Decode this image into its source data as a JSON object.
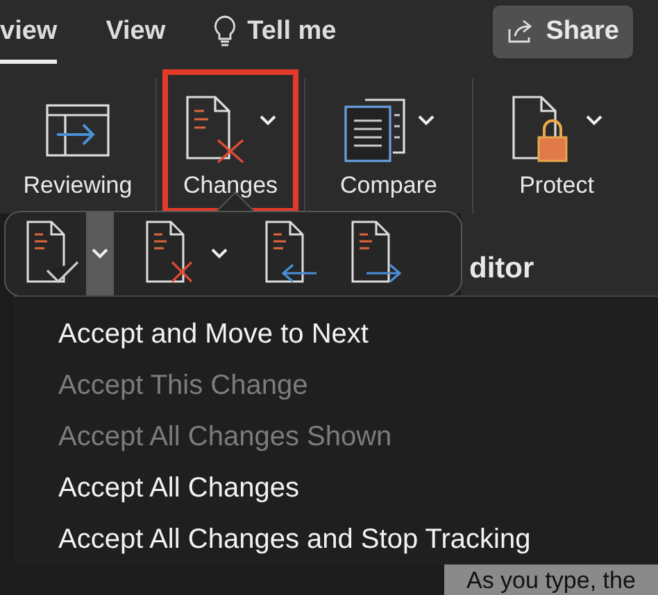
{
  "tabs": [
    {
      "label": "view",
      "selected": true
    },
    {
      "label": "View",
      "selected": false
    }
  ],
  "tell_me": {
    "label": "Tell me"
  },
  "share_button": {
    "label": "Share"
  },
  "ribbon": [
    {
      "kind": "reviewing",
      "label": "Reviewing",
      "has_dropdown": false,
      "highlighted": false
    },
    {
      "kind": "changes",
      "label": "Changes",
      "has_dropdown": true,
      "highlighted": true
    },
    {
      "kind": "compare",
      "label": "Compare",
      "has_dropdown": true,
      "highlighted": false
    },
    {
      "kind": "protect",
      "label": "Protect",
      "has_dropdown": true,
      "highlighted": false
    }
  ],
  "popover_tools": [
    {
      "kind": "accept",
      "has_dropdown": true,
      "dropdown_selected": true
    },
    {
      "kind": "reject",
      "has_dropdown": true,
      "dropdown_selected": false
    },
    {
      "kind": "previous"
    },
    {
      "kind": "next"
    }
  ],
  "menu": [
    {
      "label": "Accept and Move to Next",
      "disabled": false
    },
    {
      "label": "Accept This Change",
      "disabled": true
    },
    {
      "label": "Accept All Changes Shown",
      "disabled": true
    },
    {
      "label": "Accept All Changes",
      "disabled": false
    },
    {
      "label": "Accept All Changes and Stop Tracking",
      "disabled": false
    }
  ],
  "editor_pane": {
    "title": "ditor"
  },
  "document": {
    "text": "As you type, the"
  }
}
